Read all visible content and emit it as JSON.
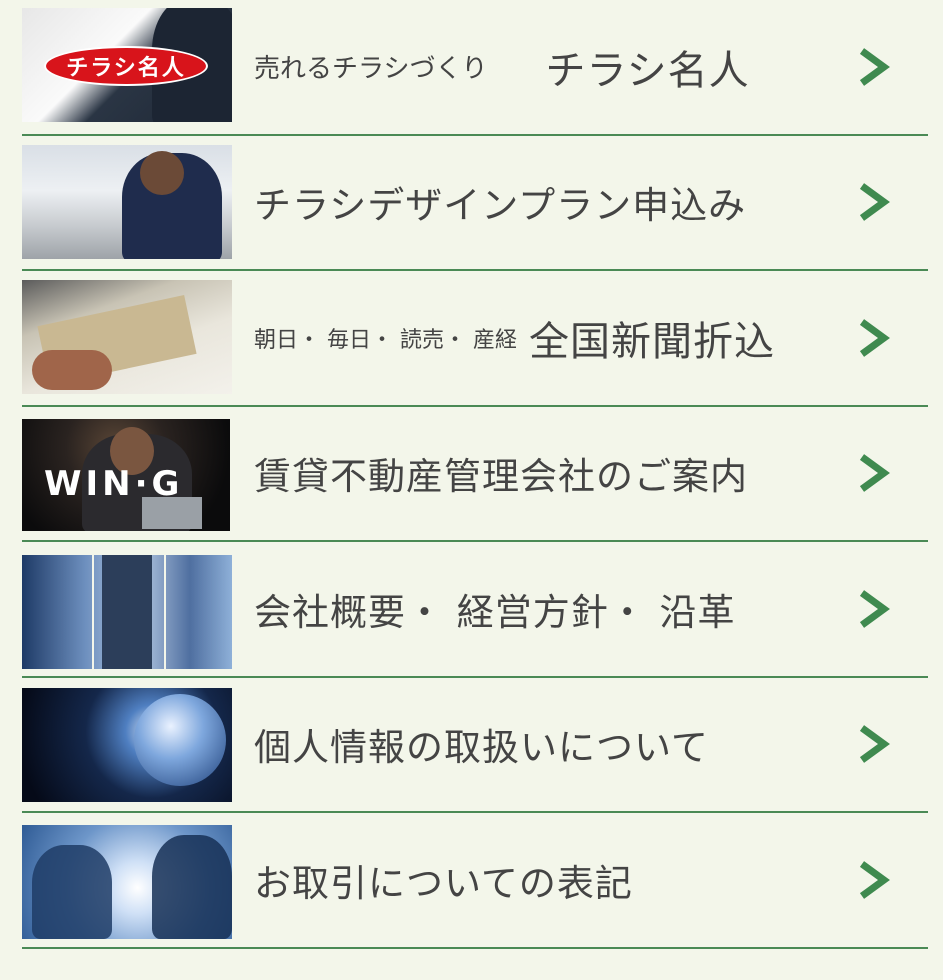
{
  "menu": [
    {
      "thumb": "thumb-chirashi-meijin",
      "logo_text": "チラシ名人",
      "subtitle": "売れるチラシづくり",
      "title": "チラシ名人"
    },
    {
      "thumb": "thumb-design-plan",
      "title": "チラシデザインプラン申込み"
    },
    {
      "thumb": "thumb-newspaper",
      "subtitle": "朝日・ 毎日・ 読売・ 産経",
      "title": "全国新聞折込"
    },
    {
      "thumb": "thumb-wing-g",
      "logo_text": "WIN·G",
      "title": "賃貸不動産管理会社のご案内"
    },
    {
      "thumb": "thumb-company",
      "title": "会社概要・ 経営方針・ 沿革"
    },
    {
      "thumb": "thumb-globe",
      "title": "個人情報の取扱いについて"
    },
    {
      "thumb": "thumb-handshake",
      "title": "お取引についての表記"
    }
  ],
  "colors": {
    "background": "#f3f6ea",
    "divider": "#4a8a55",
    "chevron": "#3f8a4f",
    "text": "#444444"
  },
  "icons": {
    "chevron": "chevron-right-icon"
  }
}
